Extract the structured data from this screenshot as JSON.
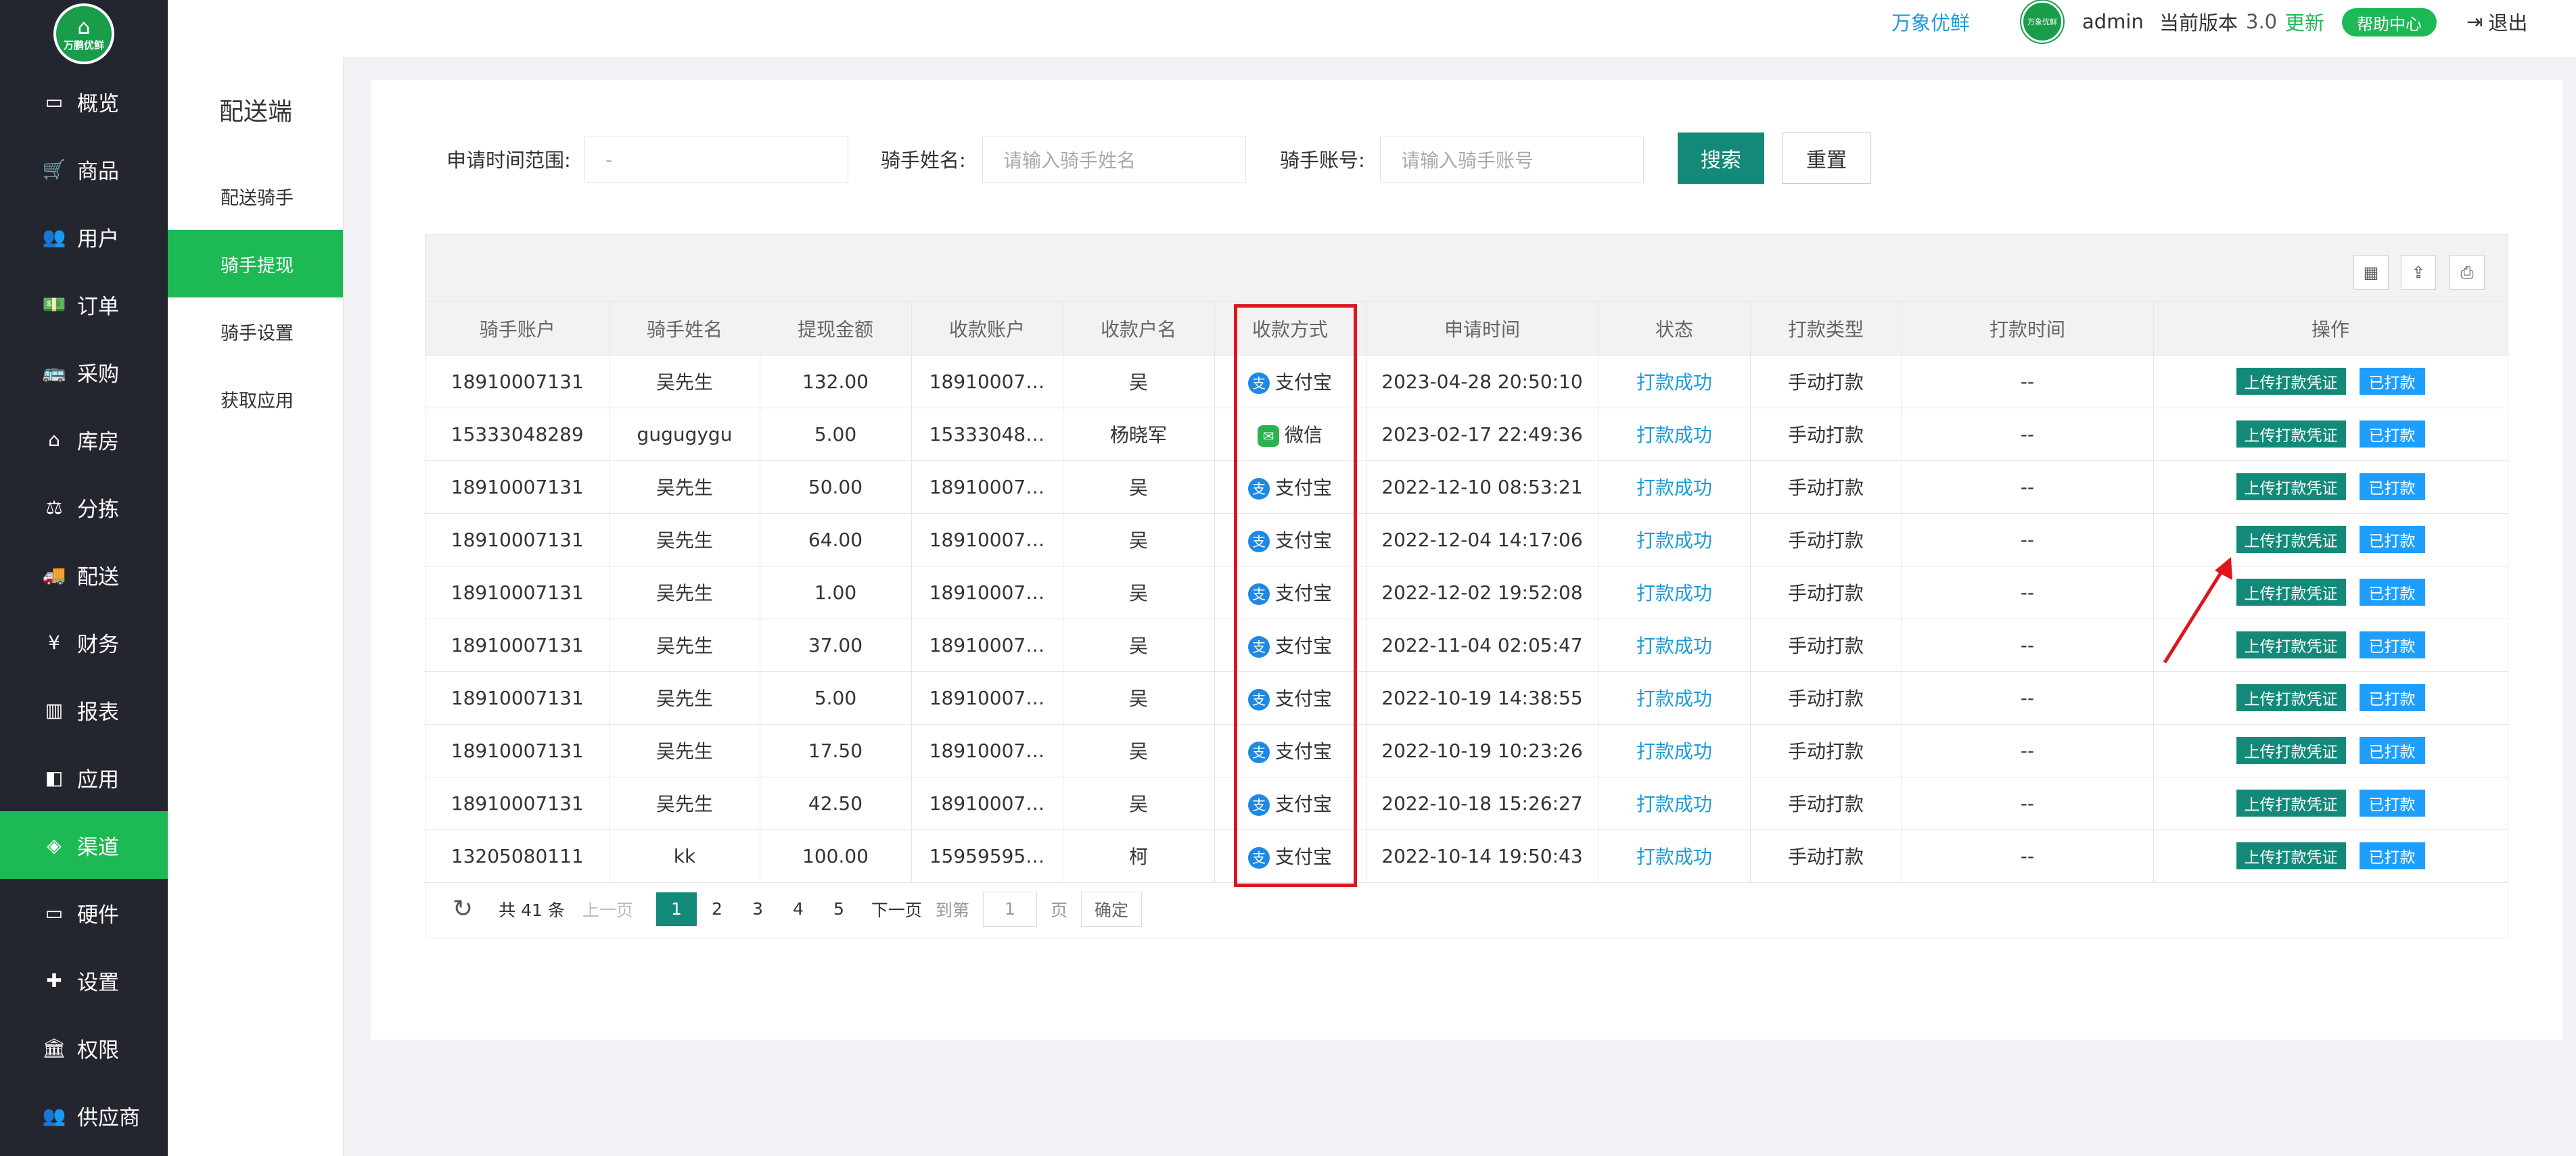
{
  "brand": {
    "logo_text": "万鹏优鲜",
    "name": "万象优鲜"
  },
  "header": {
    "avatar_text": "万象优鲜",
    "user": "admin",
    "version_label": "当前版本",
    "version": "3.0",
    "update": "更新",
    "help": "帮助中心",
    "logout": "退出"
  },
  "sidebar": {
    "items": [
      {
        "label": "概览",
        "icon": "monitor-icon"
      },
      {
        "label": "商品",
        "icon": "cart-icon"
      },
      {
        "label": "用户",
        "icon": "users-icon"
      },
      {
        "label": "订单",
        "icon": "money-icon"
      },
      {
        "label": "采购",
        "icon": "bus-icon"
      },
      {
        "label": "库房",
        "icon": "home-icon"
      },
      {
        "label": "分拣",
        "icon": "balance-icon"
      },
      {
        "label": "配送",
        "icon": "truck-icon"
      },
      {
        "label": "财务",
        "icon": "yen-icon"
      },
      {
        "label": "报表",
        "icon": "bar-chart-icon"
      },
      {
        "label": "应用",
        "icon": "apps-icon"
      },
      {
        "label": "渠道",
        "icon": "cube-icon"
      },
      {
        "label": "硬件",
        "icon": "desktop-icon"
      },
      {
        "label": "设置",
        "icon": "puzzle-icon"
      },
      {
        "label": "权限",
        "icon": "bank-icon"
      },
      {
        "label": "供应商",
        "icon": "supplier-icon"
      }
    ],
    "active": "渠道"
  },
  "subnav": {
    "title": "配送端",
    "items": [
      "配送骑手",
      "骑手提现",
      "骑手设置",
      "获取应用"
    ],
    "active": "骑手提现"
  },
  "search": {
    "time_label": "申请时间范围:",
    "time_value": "-",
    "name_label": "骑手姓名:",
    "name_placeholder": "请输入骑手姓名",
    "account_label": "骑手账号:",
    "account_placeholder": "请输入骑手账号",
    "search_btn": "搜索",
    "reset_btn": "重置"
  },
  "table": {
    "columns": [
      "骑手账户",
      "骑手姓名",
      "提现金额",
      "收款账户",
      "收款户名",
      "收款方式",
      "申请时间",
      "状态",
      "打款类型",
      "打款时间",
      "操作"
    ],
    "rows": [
      [
        "18910007131",
        "吴先生",
        "132.00",
        "18910007…",
        "吴",
        "支付宝",
        "2023-04-28 20:50:10",
        "打款成功",
        "手动打款",
        "--"
      ],
      [
        "15333048289",
        "gugugygu",
        "5.00",
        "15333048…",
        "杨晓军",
        "微信",
        "2023-02-17 22:49:36",
        "打款成功",
        "手动打款",
        "--"
      ],
      [
        "18910007131",
        "吴先生",
        "50.00",
        "18910007…",
        "吴",
        "支付宝",
        "2022-12-10 08:53:21",
        "打款成功",
        "手动打款",
        "--"
      ],
      [
        "18910007131",
        "吴先生",
        "64.00",
        "18910007…",
        "吴",
        "支付宝",
        "2022-12-04 14:17:06",
        "打款成功",
        "手动打款",
        "--"
      ],
      [
        "18910007131",
        "吴先生",
        "1.00",
        "18910007…",
        "吴",
        "支付宝",
        "2022-12-02 19:52:08",
        "打款成功",
        "手动打款",
        "--"
      ],
      [
        "18910007131",
        "吴先生",
        "37.00",
        "18910007…",
        "吴",
        "支付宝",
        "2022-11-04 02:05:47",
        "打款成功",
        "手动打款",
        "--"
      ],
      [
        "18910007131",
        "吴先生",
        "5.00",
        "18910007…",
        "吴",
        "支付宝",
        "2022-10-19 14:38:55",
        "打款成功",
        "手动打款",
        "--"
      ],
      [
        "18910007131",
        "吴先生",
        "17.50",
        "18910007…",
        "吴",
        "支付宝",
        "2022-10-19 10:23:26",
        "打款成功",
        "手动打款",
        "--"
      ],
      [
        "18910007131",
        "吴先生",
        "42.50",
        "18910007…",
        "吴",
        "支付宝",
        "2022-10-18 15:26:27",
        "打款成功",
        "手动打款",
        "--"
      ],
      [
        "13205080111",
        "kk",
        "100.00",
        "15959595…",
        "柯",
        "支付宝",
        "2022-10-14 19:50:43",
        "打款成功",
        "手动打款",
        "--"
      ]
    ],
    "op_upload": "上传打款凭证",
    "op_paid": "已打款"
  },
  "pager": {
    "total": "共 41 条",
    "prev": "上一页",
    "pages": [
      "1",
      "2",
      "3",
      "4",
      "5"
    ],
    "current": "1",
    "next": "下一页",
    "goto": "到第",
    "goto_value": "1",
    "page_unit": "页",
    "confirm": "确定"
  },
  "colors": {
    "accent": "#1db954",
    "primary_btn": "#138a79",
    "link": "#1a9cd6",
    "highlight": "#e0141e",
    "sidebar_bg": "#23262e"
  }
}
